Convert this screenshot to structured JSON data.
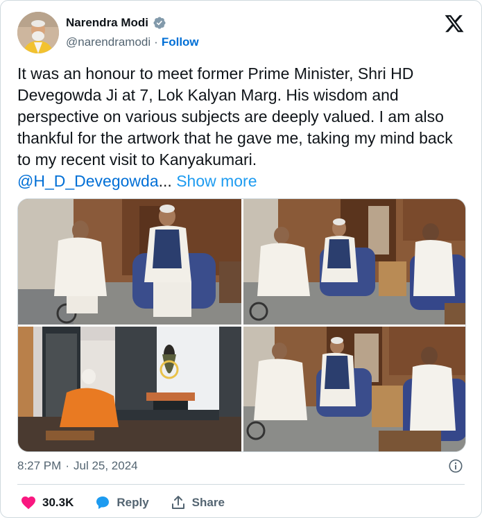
{
  "author": {
    "display_name": "Narendra Modi",
    "handle": "@narendramodi",
    "separator": "·",
    "follow_label": "Follow",
    "verified": true
  },
  "brand": {
    "logo": "x-logo-icon"
  },
  "tweet": {
    "text": "It was an honour to meet former Prime Minister, Shri HD Devegowda Ji at 7, Lok Kalyan Marg. His wisdom and perspective on various subjects are deeply valued. I am also thankful for the artwork that he gave me, taking my mind back to my recent visit to Kanyakumari.",
    "mention": "@H_D_Devegowda",
    "ellipsis": "...",
    "show_more": "Show more"
  },
  "media": {
    "count": 4,
    "images": [
      "photo-two-leaders-seated",
      "photo-three-leaders-seated",
      "photo-artwork-kanyakumari-meditation",
      "photo-three-leaders-wide"
    ]
  },
  "meta": {
    "time": "8:27 PM",
    "separator": "·",
    "date": "Jul 25, 2024"
  },
  "actions": {
    "like_count": "30.3K",
    "reply_label": "Reply",
    "share_label": "Share"
  },
  "colors": {
    "accent": "#1d9bf0",
    "follow": "#006fd6",
    "like": "#f91880",
    "secondary_text": "#536471",
    "border": "#cfd9de"
  }
}
